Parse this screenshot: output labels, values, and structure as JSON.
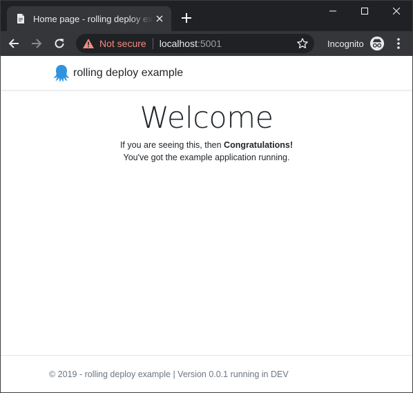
{
  "browser": {
    "tab": {
      "title": "Home page - rolling deploy example"
    },
    "omnibox": {
      "security_label": "Not secure",
      "url_host": "localhost",
      "url_port": ":5001"
    },
    "incognito_label": "Incognito"
  },
  "site": {
    "brand": "rolling deploy example",
    "hero": {
      "title": "Welcome",
      "line1_prefix": "If you are seeing this, then ",
      "line1_bold": "Congratulations!",
      "line2": "You've got the example application running."
    },
    "footer": "© 2019 - rolling deploy example | Version 0.0.1 running in DEV"
  },
  "colors": {
    "titlebar": "#202124",
    "toolbar": "#35363a",
    "warning": "#f28b82",
    "brand_logo": "#2f93e0"
  }
}
